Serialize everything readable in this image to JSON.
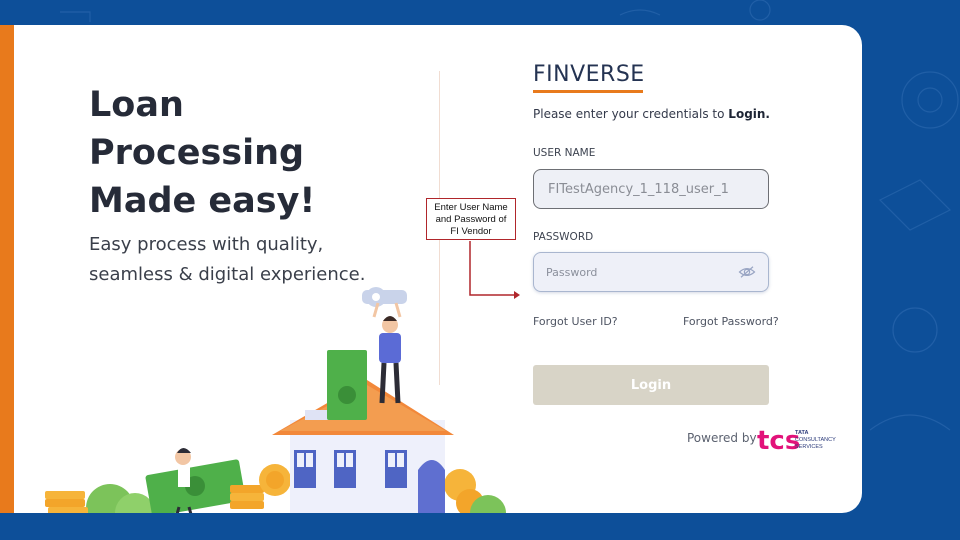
{
  "hero": {
    "title_line1": "Loan",
    "title_line2": "Processing",
    "title_line3": "Made easy!",
    "subtitle": "Easy process with quality,\nseamless & digital experience."
  },
  "annotation": {
    "callout_text": "Enter User Name\nand Password of\nFI Vendor",
    "border_color": "#b0262b"
  },
  "login": {
    "brand": "FINVERSE",
    "intro_prefix": "Please enter your credentials to ",
    "intro_bold": "Login.",
    "username_label": "USER NAME",
    "username_value": "FITestAgency_1_118_user_1",
    "password_label": "PASSWORD",
    "password_placeholder": "Password",
    "password_toggle_icon": "eye-off-icon",
    "forgot_user_id": "Forgot User ID?",
    "forgot_password": "Forgot Password?",
    "login_button": "Login",
    "powered_by": "Powered by",
    "logo_mark": "tcs",
    "logo_text_lines": [
      "TATA",
      "CONSULTANCY",
      "SERVICES"
    ]
  },
  "colors": {
    "background": "#0d4f99",
    "accent_orange": "#e87a1c",
    "login_button": "#d8d4c7",
    "logo_magenta": "#e2127a"
  }
}
